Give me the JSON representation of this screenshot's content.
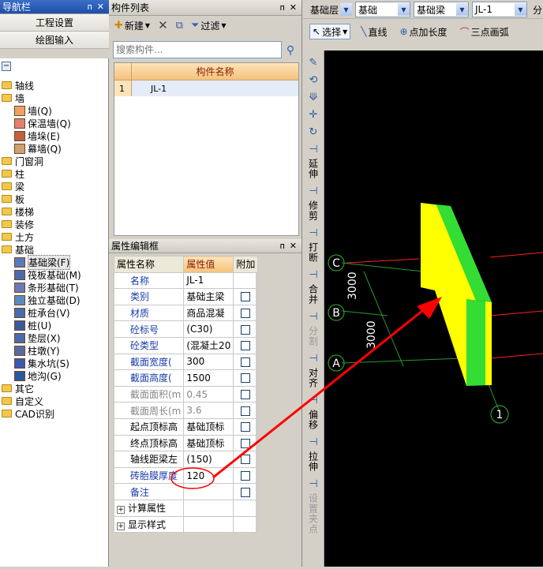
{
  "nav": {
    "title": "导航栏",
    "btn1": "工程设置",
    "btn2": "绘图输入",
    "tree": [
      {
        "label": "轴线",
        "level": 0,
        "type": "folder"
      },
      {
        "label": "墙",
        "level": 0,
        "type": "folder"
      },
      {
        "label": "墙(Q)",
        "level": 1,
        "type": "item"
      },
      {
        "label": "保温墙(Q)",
        "level": 1,
        "type": "item"
      },
      {
        "label": "墙垛(E)",
        "level": 1,
        "type": "item"
      },
      {
        "label": "幕墙(Q)",
        "level": 1,
        "type": "item"
      },
      {
        "label": "门窗洞",
        "level": 0,
        "type": "folder"
      },
      {
        "label": "柱",
        "level": 0,
        "type": "folder"
      },
      {
        "label": "梁",
        "level": 0,
        "type": "folder"
      },
      {
        "label": "板",
        "level": 0,
        "type": "folder"
      },
      {
        "label": "楼梯",
        "level": 0,
        "type": "folder"
      },
      {
        "label": "装修",
        "level": 0,
        "type": "folder"
      },
      {
        "label": "土方",
        "level": 0,
        "type": "folder"
      },
      {
        "label": "基础",
        "level": 0,
        "type": "folder"
      },
      {
        "label": "基础梁(F)",
        "level": 1,
        "type": "item"
      },
      {
        "label": "筏板基础(M)",
        "level": 1,
        "type": "item"
      },
      {
        "label": "条形基础(T)",
        "level": 1,
        "type": "item"
      },
      {
        "label": "独立基础(D)",
        "level": 1,
        "type": "item"
      },
      {
        "label": "桩承台(V)",
        "level": 1,
        "type": "item"
      },
      {
        "label": "桩(U)",
        "level": 1,
        "type": "item"
      },
      {
        "label": "垫层(X)",
        "level": 1,
        "type": "item"
      },
      {
        "label": "柱墩(Y)",
        "level": 1,
        "type": "item"
      },
      {
        "label": "集水坑(S)",
        "level": 1,
        "type": "item"
      },
      {
        "label": "地沟(G)",
        "level": 1,
        "type": "item"
      },
      {
        "label": "其它",
        "level": 0,
        "type": "folder"
      },
      {
        "label": "自定义",
        "level": 0,
        "type": "folder"
      },
      {
        "label": "CAD识别",
        "level": 0,
        "type": "folder"
      }
    ]
  },
  "components": {
    "title": "构件列表",
    "new_label": "新建",
    "filter_label": "过滤",
    "search_placeholder": "搜索构件...",
    "column_header": "构件名称",
    "rows": [
      {
        "num": "1",
        "name": "JL-1"
      }
    ]
  },
  "props": {
    "title": "属性编辑框",
    "headers": {
      "name": "属性名称",
      "value": "属性值",
      "extra": "附加"
    },
    "rows": [
      {
        "name": "名称",
        "value": "JL-1",
        "cb": false,
        "color": "#1a3aa8"
      },
      {
        "name": "类别",
        "value": "基础主梁",
        "cb": true,
        "color": "#1a3aa8"
      },
      {
        "name": "材质",
        "value": "商品混凝",
        "cb": true,
        "color": "#1a3aa8"
      },
      {
        "name": "砼标号",
        "value": "(C30)",
        "cb": true,
        "color": "#1a3aa8"
      },
      {
        "name": "砼类型",
        "value": "(混凝土20",
        "cb": true,
        "color": "#1a3aa8"
      },
      {
        "name": "截面宽度(",
        "value": "300",
        "cb": true,
        "color": "#1a3aa8"
      },
      {
        "name": "截面高度(",
        "value": "1500",
        "cb": true,
        "color": "#1a3aa8"
      },
      {
        "name": "截面面积(m",
        "value": "0.45",
        "cb": true,
        "color": "#888888"
      },
      {
        "name": "截面周长(m",
        "value": "3.6",
        "cb": true,
        "color": "#888888"
      },
      {
        "name": "起点顶标高",
        "value": "基础顶标",
        "cb": true,
        "color": "#000000"
      },
      {
        "name": "终点顶标高",
        "value": "基础顶标",
        "cb": true,
        "color": "#000000"
      },
      {
        "name": "轴线距梁左",
        "value": "(150)",
        "cb": true,
        "color": "#000000"
      },
      {
        "name": "砖胎膜厚度",
        "value": "120",
        "cb": true,
        "color": "#1a3aa8"
      },
      {
        "name": "备注",
        "value": "",
        "cb": true,
        "color": "#1a3aa8"
      }
    ],
    "groups": [
      "计算属性",
      "显示样式"
    ]
  },
  "topbar": {
    "combos": [
      "基础层",
      "基础",
      "基础梁",
      "JL-1",
      "分..."
    ],
    "select_label": "选择",
    "line_label": "直线",
    "point_length_label": "点加长度",
    "arc_label": "三点画弧"
  },
  "vtoolbar": [
    "延伸",
    "修剪",
    "打断",
    "合并",
    "分割",
    "对齐",
    "偏移",
    "拉伸",
    "设置夹点"
  ],
  "canvas": {
    "axis_labels": [
      "C",
      "B",
      "A",
      "1"
    ],
    "dims": [
      "3000",
      "3000"
    ]
  },
  "colors": {
    "accent": "#ff0000",
    "beam_yellow": "#ffff00",
    "beam_green": "#33dd33"
  }
}
